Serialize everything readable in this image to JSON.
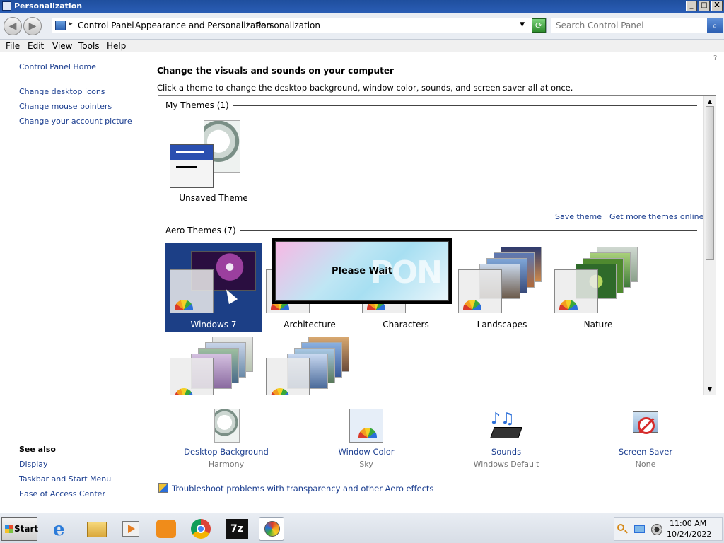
{
  "window": {
    "title": "Personalization",
    "min": "_",
    "max": "□",
    "close": "X"
  },
  "nav": {
    "back_glyph": "◀",
    "forward_glyph": "▶",
    "breadcrumbs": [
      "Control Panel",
      "Appearance and Personalization",
      "Personalization"
    ],
    "refresh_glyph": "⟳",
    "search_placeholder": "Search Control Panel",
    "search_glyph": "⌕"
  },
  "menu": [
    "File",
    "Edit",
    "View",
    "Tools",
    "Help"
  ],
  "left_pane": {
    "home": "Control Panel Home",
    "links": [
      "Change desktop icons",
      "Change mouse pointers",
      "Change your account picture"
    ],
    "see_also_title": "See also",
    "see_also": [
      "Display",
      "Taskbar and Start Menu",
      "Ease of Access Center"
    ]
  },
  "main": {
    "heading": "Change the visuals and sounds on your computer",
    "subheading": "Click a theme to change the desktop background, window color, sounds, and screen saver all at once.",
    "my_themes_title": "My Themes (1)",
    "unsaved_theme": "Unsaved Theme",
    "save_theme": "Save theme",
    "more_themes": "Get more themes online",
    "aero_title": "Aero Themes (7)",
    "aero_themes": [
      "Windows 7",
      "Architecture",
      "Characters",
      "Landscapes",
      "Nature"
    ],
    "please_wait": "Please Wait",
    "please_wait_decor": "PON"
  },
  "settings": [
    {
      "label": "Desktop Background",
      "value": "Harmony"
    },
    {
      "label": "Window Color",
      "value": "Sky"
    },
    {
      "label": "Sounds",
      "value": "Windows Default"
    },
    {
      "label": "Screen Saver",
      "value": "None"
    }
  ],
  "troubleshoot": "Troubleshoot problems with transparency and other Aero effects",
  "taskbar": {
    "start": "Start",
    "sevenzip": "7z",
    "time": "11:00 AM",
    "date": "10/24/2022"
  },
  "colors": {
    "title_bar": "#1f4f9e",
    "link": "#1a3d8f",
    "selected_theme": "#1c3f86"
  }
}
